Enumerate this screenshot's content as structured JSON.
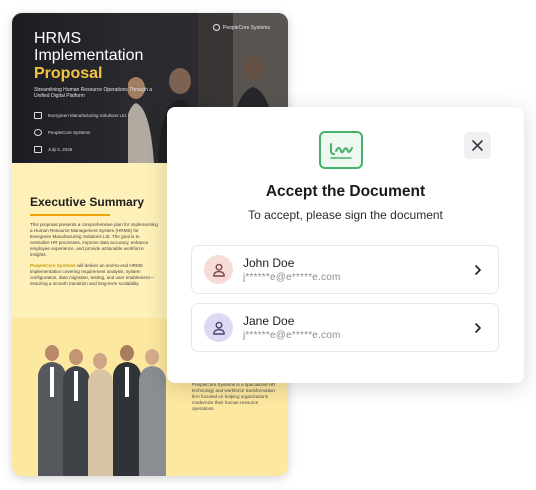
{
  "document": {
    "brand": "PeopleCore Systems",
    "title_line1": "HRMS",
    "title_line2": "Implementation",
    "title_line3": "Proposal",
    "subtitle": "Streamlining Human Resource Operations Through a Unified Digital Platform",
    "client": "Evergreen Manufacturing Solutions Ltd.",
    "vendor": "PeopleCore Systems",
    "date": "July 6, 2025",
    "summary_heading": "Executive Summary",
    "summary_p1": "This proposal presents a comprehensive plan for implementing a Human Resource Management System (HRMS) for Evergreen Manufacturing Solutions Ltd. The goal is to centralize HR processes, improve data accuracy, enhance employee experience, and provide actionable workforce insights.",
    "summary_p2_highlight": "PeopleCore Systems",
    "summary_p2_rest": " will deliver an end-to-end HRMS implementation covering requirement analysis, system configuration, data migration, testing, and user enablement—ensuring a smooth transition and long-term scalability.",
    "about": "PeopleCore Systems is a specialized HR technology and workforce transformation firm focused on helping organizations modernize their human resource operations."
  },
  "modal": {
    "title": "Accept the Document",
    "subtitle": "To accept, please sign the document",
    "close_icon": "close-icon",
    "signature_icon": "signature-icon",
    "signers": [
      {
        "name": "John Doe",
        "email": "j******e@e*****e.com",
        "avatar_color": "#f6dbd6",
        "icon_color": "#7a4a44"
      },
      {
        "name": "Jane Doe",
        "email": "j******e@e*****e.com",
        "avatar_color": "#dcd9f3",
        "icon_color": "#4a4670"
      }
    ]
  },
  "colors": {
    "accent_green": "#46b16a",
    "doc_yellow": "#fdf0b8",
    "title_gold": "#f4c542"
  }
}
